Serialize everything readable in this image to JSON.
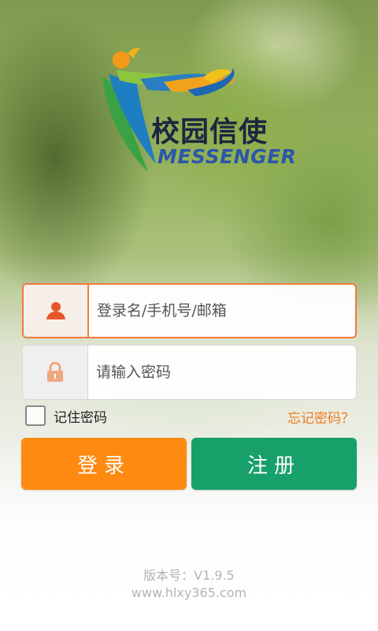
{
  "app": {
    "logo_cn": "校园信使",
    "logo_en": "MESSENGER"
  },
  "login_form": {
    "username_placeholder": "登录名/手机号/邮箱",
    "username_value": "",
    "password_placeholder": "请输入密码",
    "password_value": "",
    "remember_label": "记住密码",
    "remember_checked": false,
    "forgot_label": "忘记密码？"
  },
  "buttons": {
    "login_label": "登录",
    "register_label": "注册"
  },
  "footer": {
    "version": "版本号：V1.9.5",
    "website": "www.hlxy365.com"
  },
  "colors": {
    "accent_orange": "#ff8a12",
    "accent_green": "#17a06a",
    "focus_border": "#f07a3e"
  },
  "icons": {
    "username": "user-icon",
    "password": "lock-icon"
  }
}
